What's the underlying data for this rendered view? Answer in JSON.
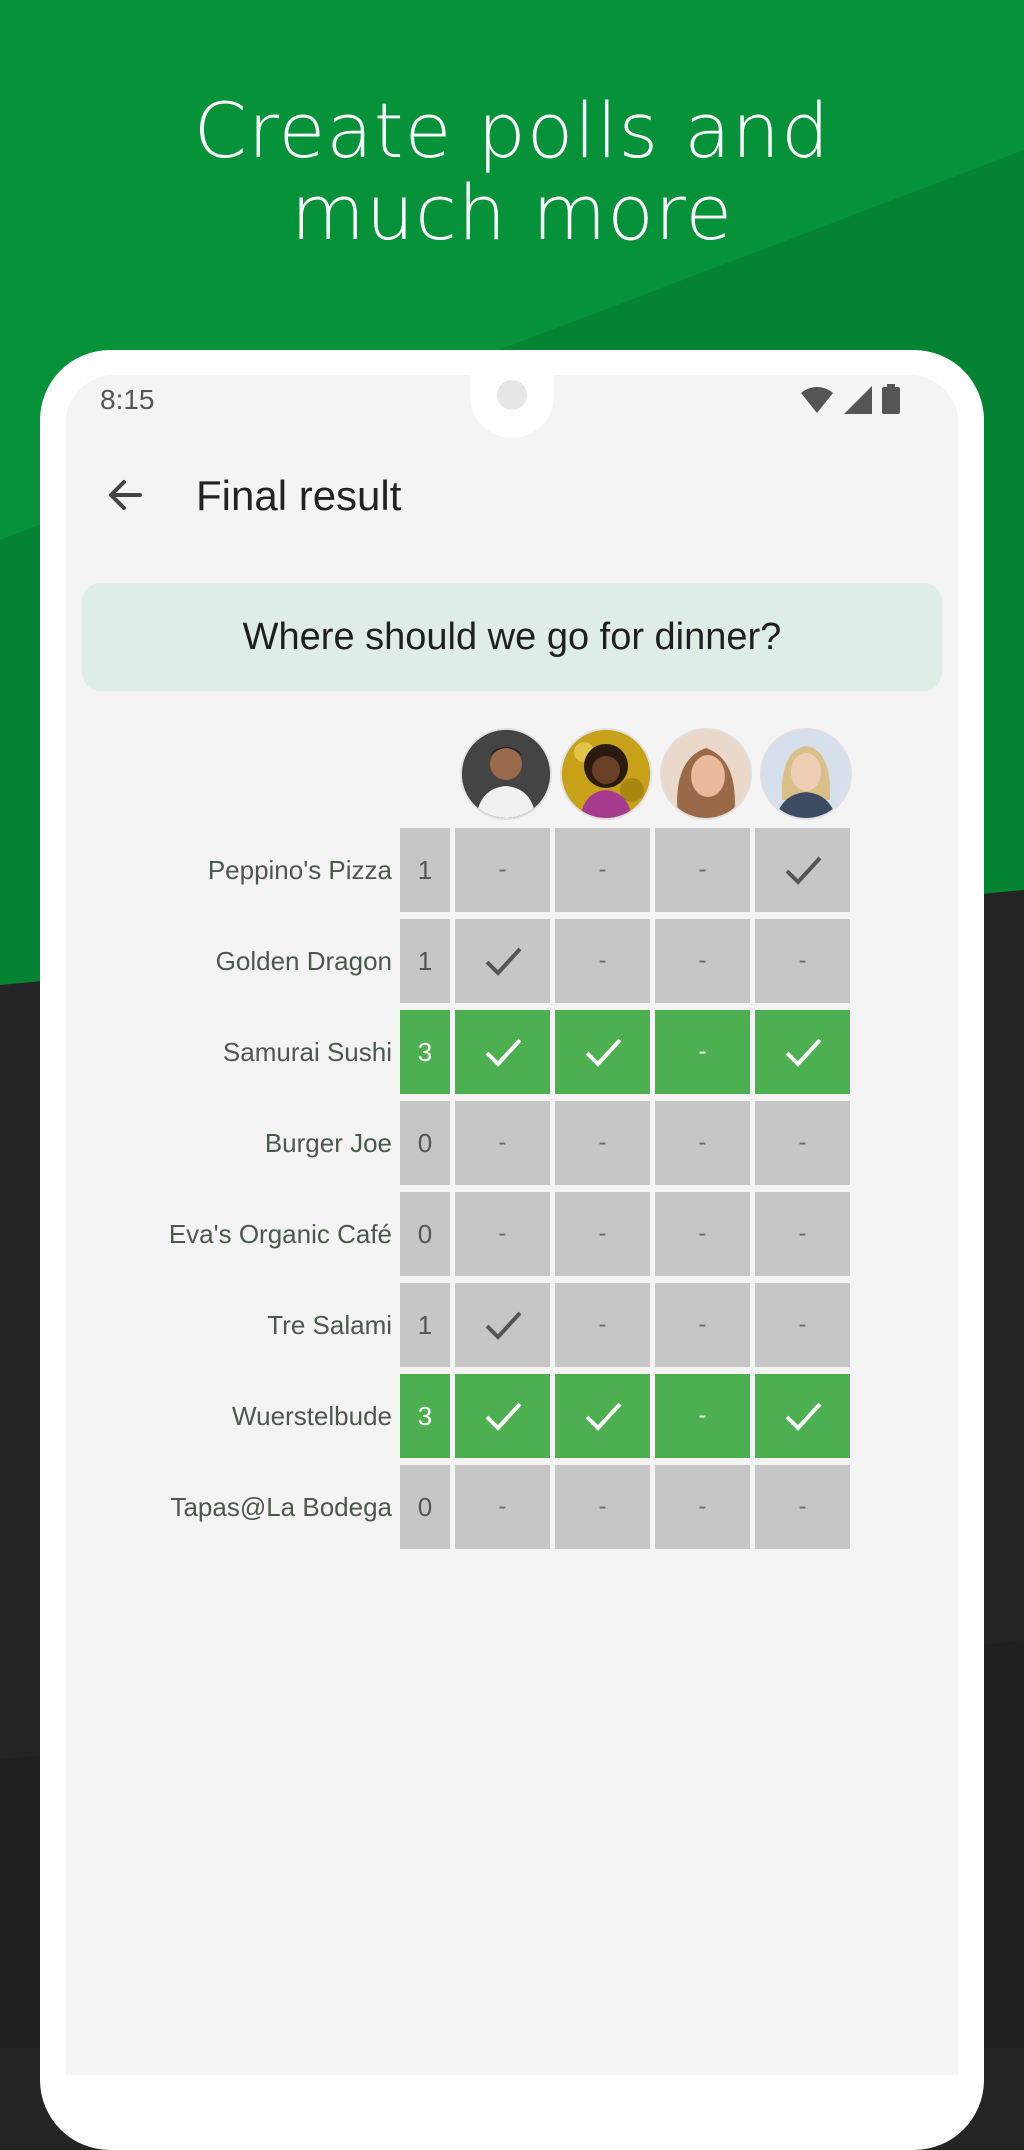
{
  "headline": "Create polls and much more",
  "status_bar": {
    "time": "8:15"
  },
  "app_bar": {
    "title": "Final result"
  },
  "question": "Where should we go for dinner?",
  "participants": [
    {
      "name": "avatar-1"
    },
    {
      "name": "avatar-2"
    },
    {
      "name": "avatar-3"
    },
    {
      "name": "avatar-4"
    }
  ],
  "options": [
    {
      "label": "Peppino's Pizza",
      "count": "1",
      "votes": [
        "-",
        "-",
        "-",
        "check"
      ],
      "highlight": false
    },
    {
      "label": "Golden Dragon",
      "count": "1",
      "votes": [
        "check",
        "-",
        "-",
        "-"
      ],
      "highlight": false
    },
    {
      "label": "Samurai Sushi",
      "count": "3",
      "votes": [
        "check",
        "check",
        "-",
        "check"
      ],
      "highlight": true
    },
    {
      "label": "Burger Joe",
      "count": "0",
      "votes": [
        "-",
        "-",
        "-",
        "-"
      ],
      "highlight": false
    },
    {
      "label": "Eva's Organic Café",
      "count": "0",
      "votes": [
        "-",
        "-",
        "-",
        "-"
      ],
      "highlight": false
    },
    {
      "label": "Tre Salami",
      "count": "1",
      "votes": [
        "check",
        "-",
        "-",
        "-"
      ],
      "highlight": false
    },
    {
      "label": "Wuerstelbude",
      "count": "3",
      "votes": [
        "check",
        "check",
        "-",
        "check"
      ],
      "highlight": true
    },
    {
      "label": "Tapas@La Bodega",
      "count": "0",
      "votes": [
        "-",
        "-",
        "-",
        "-"
      ],
      "highlight": false
    }
  ],
  "colors": {
    "brand_green": "#059238",
    "winner_green": "#4caf50",
    "cell_grey": "#c6c6c6",
    "question_bg": "#dfeee4"
  }
}
